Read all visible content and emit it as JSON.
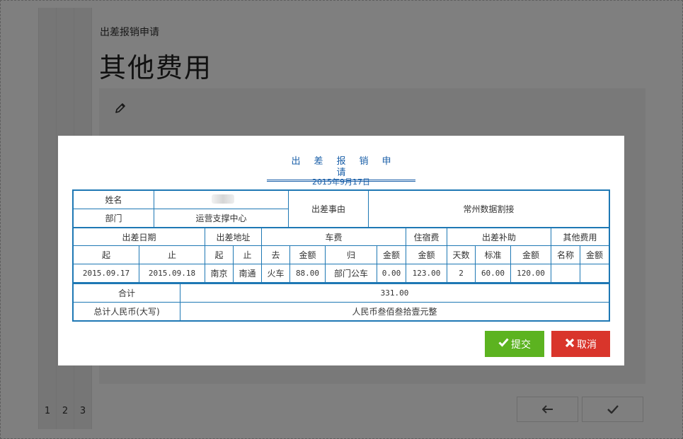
{
  "page": {
    "breadcrumb": "出差报销申请",
    "title": "其他费用",
    "steps": [
      "1",
      "2",
      "3"
    ]
  },
  "form": {
    "title": "出差报销申请",
    "date": "2015年9月17日",
    "name_label": "姓名",
    "dept_label": "部门",
    "dept_value": "运营支撑中心",
    "reason_label": "出差事由",
    "reason_value": "常州数据割接",
    "headers": {
      "date": "出差日期",
      "place": "出差地址",
      "fare": "车费",
      "lodging": "住宿费",
      "allowance": "出差补助",
      "other": "其他费用"
    },
    "subheaders": {
      "start": "起",
      "end": "止",
      "from": "起",
      "to": "止",
      "go": "去",
      "go_amount": "金额",
      "back": "归",
      "back_amount": "金额",
      "lodging_amount": "金额",
      "days": "天数",
      "standard": "标准",
      "allowance_amount": "金额",
      "other_name": "名称",
      "other_amount": "金额"
    },
    "row": {
      "start": "2015.09.17",
      "end": "2015.09.18",
      "from": "南京",
      "to": "南通",
      "go": "火车",
      "go_amount": "88.00",
      "back": "部门公车",
      "back_amount": "0.00",
      "lodging_amount": "123.00",
      "days": "2",
      "standard": "60.00",
      "allowance_amount": "120.00",
      "other_name": "",
      "other_amount": ""
    },
    "total_label": "合计",
    "total_value": "331.00",
    "total_rmb_label": "总计人民币(大写)",
    "total_rmb_value": "人民币叁佰叁拾壹元整"
  },
  "buttons": {
    "submit": "提交",
    "cancel": "取消"
  },
  "colors": {
    "table_border": "#1e78b4",
    "title": "#1a5fa8",
    "submit": "#5cb320",
    "cancel": "#d9352b"
  },
  "icons": {
    "edit": "pencil-icon",
    "back": "arrow-left-icon",
    "confirm": "check-icon",
    "submit": "check-icon",
    "cancel": "close-icon"
  }
}
